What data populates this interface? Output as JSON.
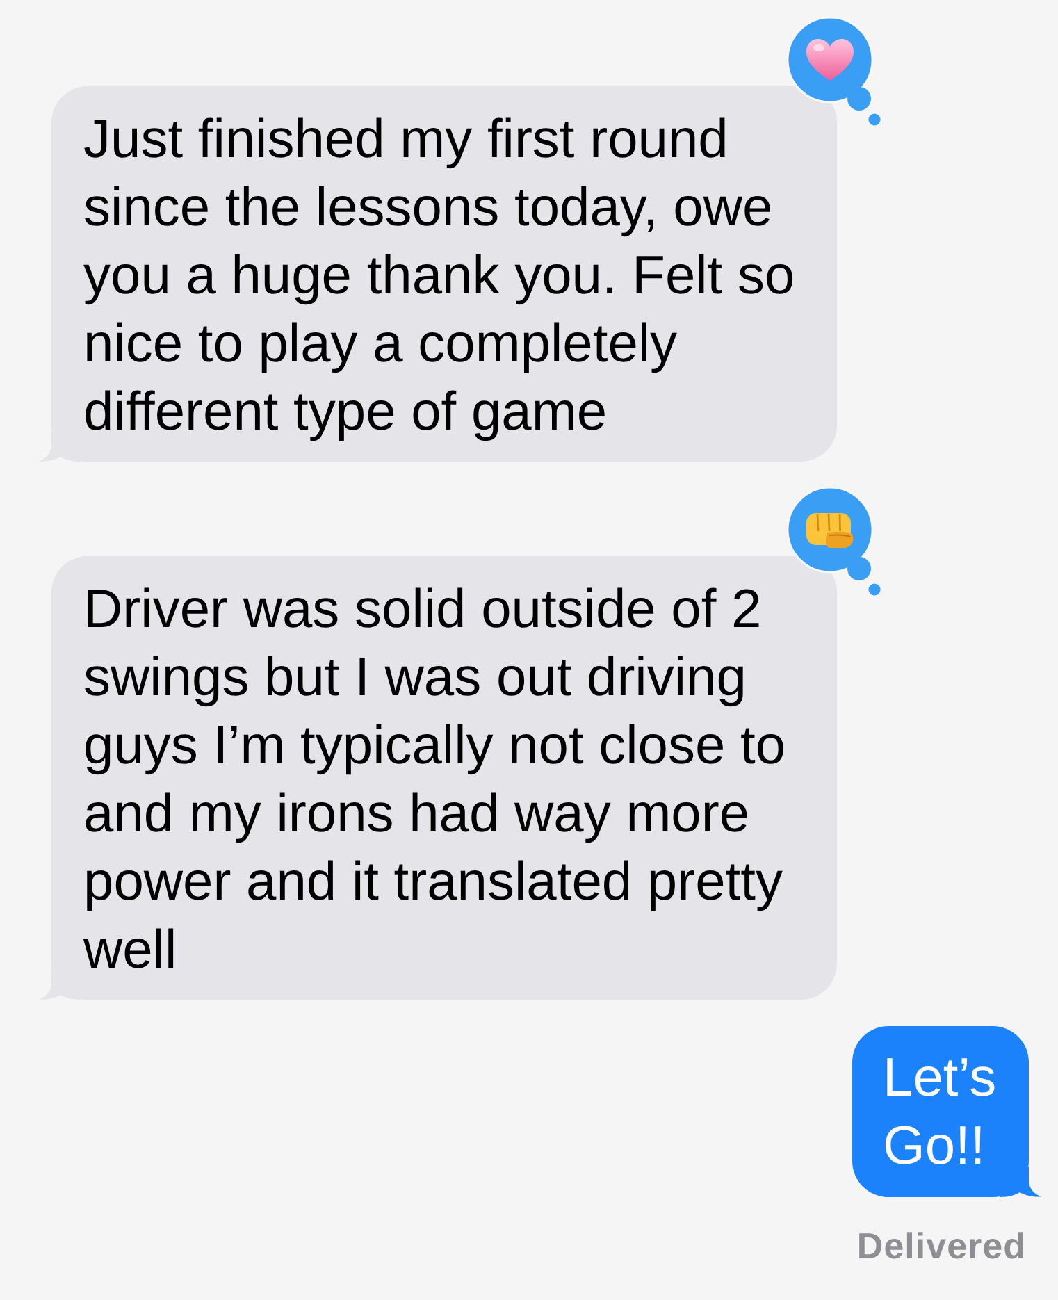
{
  "messages": [
    {
      "kind": "received",
      "text": "Just finished my first round since the lessons today, owe you a huge thank you. Felt so nice to play a completely different type of game",
      "tapback": {
        "kind": "heart"
      }
    },
    {
      "kind": "received",
      "text": "Driver was solid outside of 2 swings but I was out driving guys I’m typically not close to and my irons had way more power and it translated pretty well",
      "tapback": {
        "kind": "fist"
      }
    },
    {
      "kind": "sent",
      "text": "Let’s Go!!"
    }
  ],
  "delivery_status": "Delivered"
}
